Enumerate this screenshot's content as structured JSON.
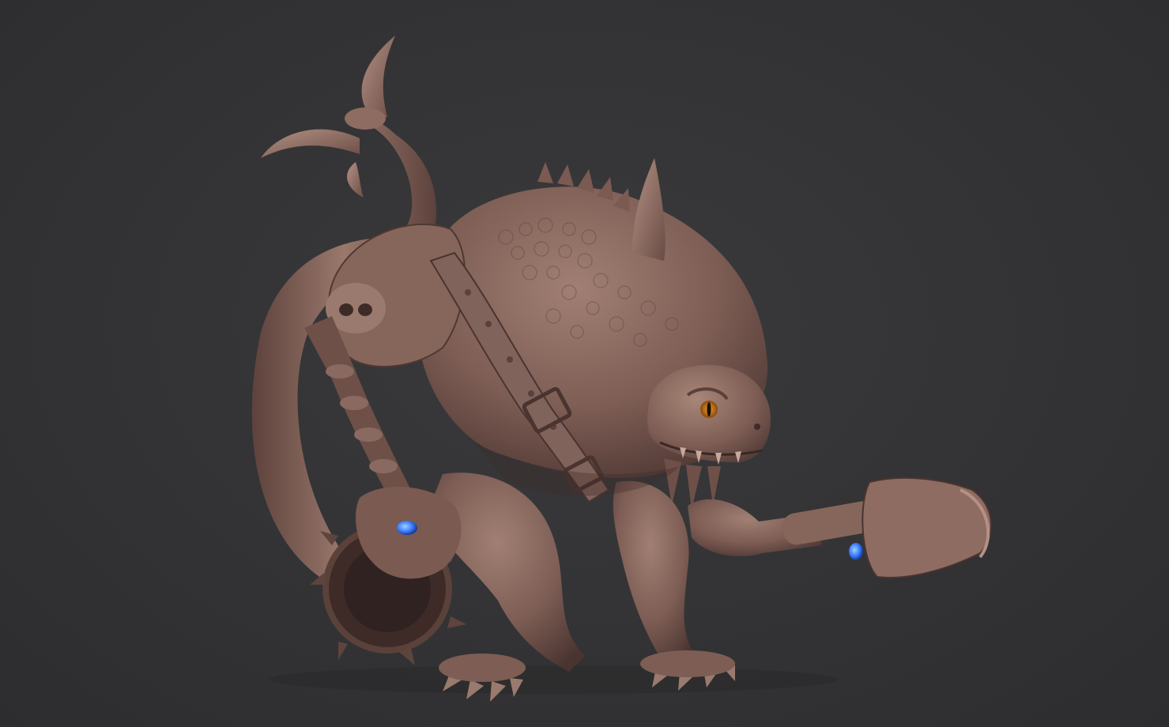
{
  "viewport": {
    "background_color": "#333335",
    "subject": "sculpt-render"
  },
  "sculpt": {
    "clay_color": "#8a6a60",
    "clay_shadow": "#4a3430",
    "clay_highlight": "#b08c80",
    "eye_color": "#d27a10",
    "gem_color": "#3a7cff"
  }
}
